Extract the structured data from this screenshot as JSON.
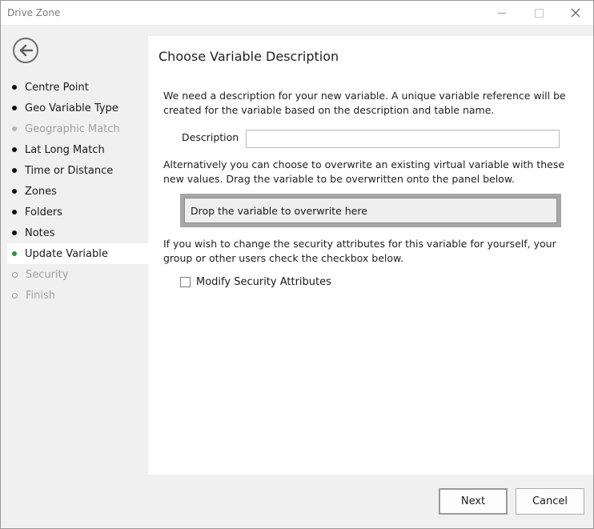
{
  "window": {
    "title": "Drive Zone"
  },
  "nav": {
    "items": [
      {
        "label": "Centre Point",
        "state": "done"
      },
      {
        "label": "Geo Variable Type",
        "state": "done"
      },
      {
        "label": "Geographic Match",
        "state": "disabled"
      },
      {
        "label": "Lat Long Match",
        "state": "done"
      },
      {
        "label": "Time or Distance",
        "state": "done"
      },
      {
        "label": "Zones",
        "state": "done"
      },
      {
        "label": "Folders",
        "state": "done"
      },
      {
        "label": "Notes",
        "state": "done"
      },
      {
        "label": "Update Variable",
        "state": "active"
      },
      {
        "label": "Security",
        "state": "pending"
      },
      {
        "label": "Finish",
        "state": "pending"
      }
    ]
  },
  "content": {
    "heading": "Choose Variable Description",
    "intro": "We need a description for your new variable.  A unique variable reference will be created for the variable based on the description and table name.",
    "description_label": "Description",
    "description_value": "",
    "overwrite_text": "Alternatively you can choose to overwrite an existing virtual variable with these new values. Drag the variable to be overwritten onto the panel below.",
    "drop_zone": "Drop the variable to overwrite here",
    "security_text": "If you wish to change the security attributes for this variable for yourself, your group or other users check the checkbox below.",
    "modify_security_label": "Modify Security Attributes"
  },
  "buttons": {
    "next": "Next",
    "cancel": "Cancel"
  },
  "colors": {
    "active_bullet": "#2f8f3a",
    "content_bg": "#ffffff",
    "panel_bg": "#f0f0f0"
  }
}
